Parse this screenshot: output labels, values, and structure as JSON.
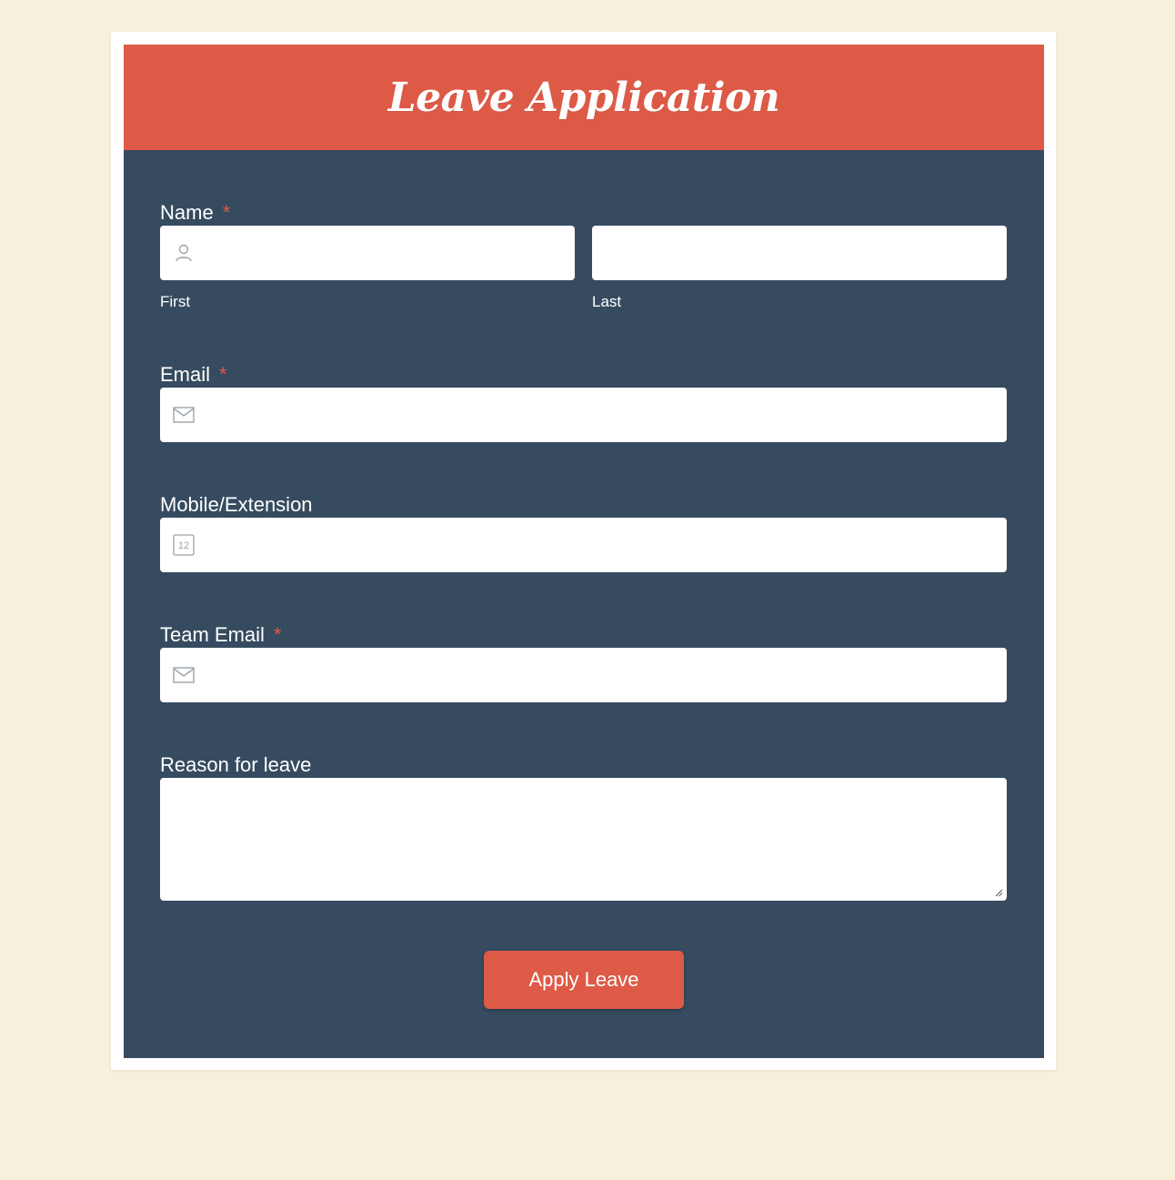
{
  "form": {
    "title": "Leave Application",
    "fields": {
      "name": {
        "label": "Name",
        "required_mark": "*",
        "first_sublabel": "First",
        "last_sublabel": "Last",
        "first_value": "",
        "last_value": "",
        "icon": "user-icon"
      },
      "email": {
        "label": "Email",
        "required_mark": "*",
        "value": "",
        "icon": "envelope-icon"
      },
      "mobile": {
        "label": "Mobile/Extension",
        "value": "",
        "icon": "phone-number-icon",
        "icon_text": "12"
      },
      "team_email": {
        "label": "Team Email",
        "required_mark": "*",
        "value": "",
        "icon": "envelope-icon"
      },
      "reason": {
        "label": "Reason for leave",
        "value": ""
      }
    },
    "submit_label": "Apply Leave"
  },
  "colors": {
    "page_background": "#f7f1dc",
    "header_background": "#dd5a47",
    "form_background": "#364b5f",
    "required_star": "#e0584a",
    "button_background": "#dd5a47"
  }
}
